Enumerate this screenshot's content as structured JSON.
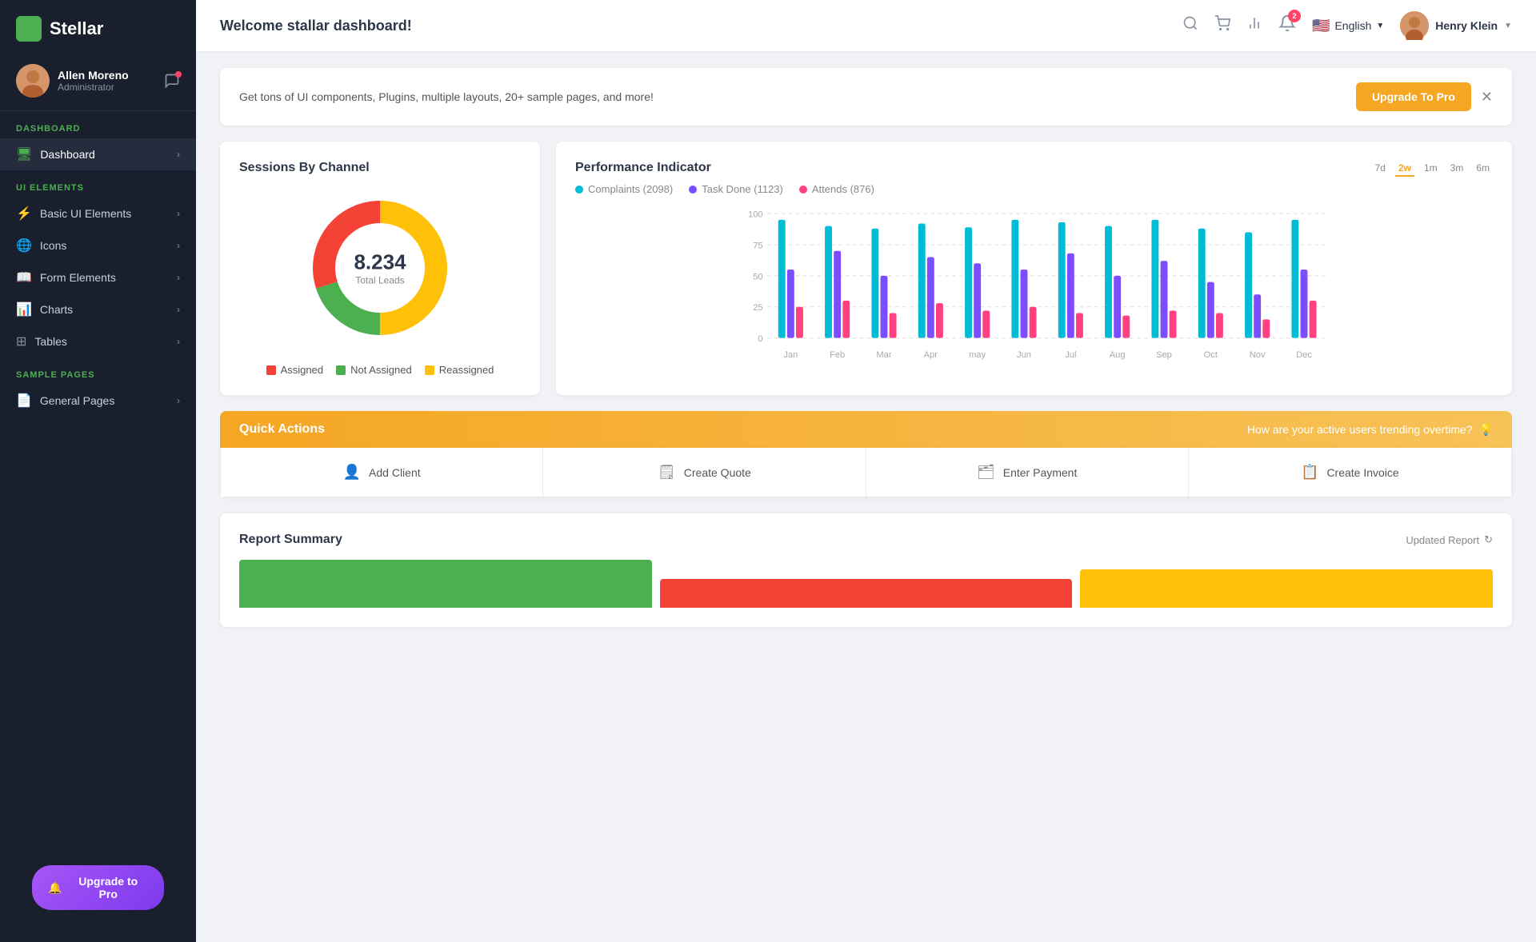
{
  "sidebar": {
    "logo": "Stellar",
    "user": {
      "name": "Allen Moreno",
      "role": "Administrator"
    },
    "sections": [
      {
        "label": "DASHBOARD",
        "items": [
          {
            "id": "dashboard",
            "label": "Dashboard",
            "icon": "🖥",
            "active": true
          }
        ]
      },
      {
        "label": "UI ELEMENTS",
        "items": [
          {
            "id": "basic-ui",
            "label": "Basic UI Elements",
            "icon": "⚡"
          },
          {
            "id": "icons",
            "label": "Icons",
            "icon": "🌐"
          },
          {
            "id": "form-elements",
            "label": "Form Elements",
            "icon": "📖"
          },
          {
            "id": "charts",
            "label": "Charts",
            "icon": "📊"
          },
          {
            "id": "tables",
            "label": "Tables",
            "icon": "⊞"
          }
        ]
      },
      {
        "label": "SAMPLE PAGES",
        "items": [
          {
            "id": "general-pages",
            "label": "General Pages",
            "icon": "📄"
          }
        ]
      }
    ],
    "upgrade_btn": "Upgrade to Pro"
  },
  "header": {
    "title": "Welcome stallar dashboard!",
    "lang": "English",
    "user_name": "Henry Klein",
    "notification_count": "2"
  },
  "banner": {
    "text": "Get tons of UI components, Plugins, multiple layouts, 20+ sample pages, and more!",
    "btn_label": "Upgrade To Pro"
  },
  "sessions_chart": {
    "title": "Sessions By Channel",
    "total": "8.234",
    "total_label": "Total Leads",
    "legend": [
      {
        "label": "Assigned",
        "color": "#f44336"
      },
      {
        "label": "Not Assigned",
        "color": "#4caf50"
      },
      {
        "label": "Reassigned",
        "color": "#ffc107"
      }
    ],
    "segments": [
      {
        "label": "Assigned",
        "value": 30,
        "color": "#f44336"
      },
      {
        "label": "Not Assigned",
        "value": 20,
        "color": "#4caf50"
      },
      {
        "label": "Reassigned",
        "value": 50,
        "color": "#ffc107"
      }
    ]
  },
  "performance_chart": {
    "title": "Performance Indicator",
    "time_filters": [
      "7d",
      "2w",
      "1m",
      "3m",
      "6m"
    ],
    "active_filter": "2w",
    "legend": [
      {
        "label": "Complaints (2098)",
        "color": "#00bcd4"
      },
      {
        "label": "Task Done (1123)",
        "color": "#7c4dff"
      },
      {
        "label": "Attends (876)",
        "color": "#ff4081"
      }
    ],
    "months": [
      "Jan",
      "Feb",
      "Mar",
      "Apr",
      "may",
      "Jun",
      "Jul",
      "Aug",
      "Sep",
      "Oct",
      "Nov",
      "Dec"
    ],
    "y_labels": [
      "100",
      "75",
      "50",
      "25",
      "0"
    ],
    "bars": [
      {
        "month": "Jan",
        "c": 95,
        "t": 55,
        "a": 25
      },
      {
        "month": "Feb",
        "c": 90,
        "t": 70,
        "a": 30
      },
      {
        "month": "Mar",
        "c": 88,
        "t": 50,
        "a": 20
      },
      {
        "month": "Apr",
        "c": 92,
        "t": 65,
        "a": 28
      },
      {
        "month": "may",
        "c": 89,
        "t": 60,
        "a": 22
      },
      {
        "month": "Jun",
        "c": 95,
        "t": 55,
        "a": 25
      },
      {
        "month": "Jul",
        "c": 93,
        "t": 68,
        "a": 20
      },
      {
        "month": "Aug",
        "c": 90,
        "t": 50,
        "a": 18
      },
      {
        "month": "Sep",
        "c": 95,
        "t": 62,
        "a": 22
      },
      {
        "month": "Oct",
        "c": 88,
        "t": 45,
        "a": 20
      },
      {
        "month": "Nov",
        "c": 85,
        "t": 35,
        "a": 15
      },
      {
        "month": "Dec",
        "c": 95,
        "t": 55,
        "a": 30
      }
    ]
  },
  "quick_actions": {
    "title": "Quick Actions",
    "subtitle": "How are your active users trending overtime?",
    "buttons": [
      {
        "id": "add-client",
        "label": "Add Client",
        "icon": "👤"
      },
      {
        "id": "create-quote",
        "label": "Create Quote",
        "icon": "🗒"
      },
      {
        "id": "enter-payment",
        "label": "Enter Payment",
        "icon": "🗂"
      },
      {
        "id": "create-invoice",
        "label": "Create Invoice",
        "icon": "📋"
      }
    ]
  },
  "report_summary": {
    "title": "Report Summary",
    "updated_label": "Updated Report"
  }
}
